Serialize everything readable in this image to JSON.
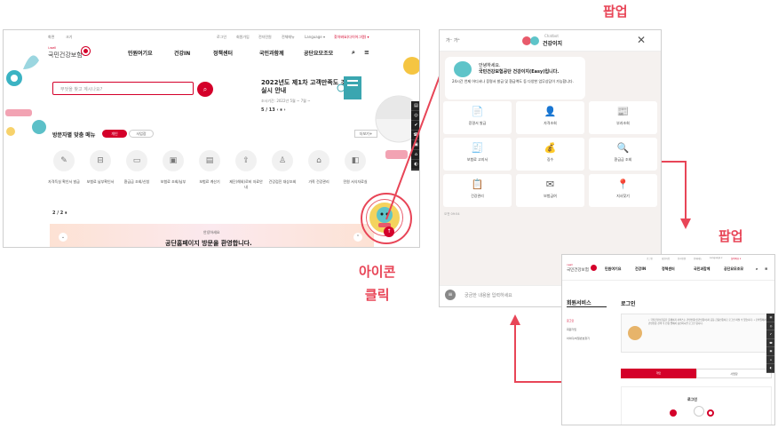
{
  "main_site": {
    "topbar": [
      "화면",
      "크기",
      "로그인",
      "회원가입",
      "전자민원",
      "전체메뉴",
      "Language ▾",
      "찾아봐요(다이어그램) ▾"
    ],
    "logo": {
      "small": "i-well",
      "text": "국민건강보험"
    },
    "gnb": [
      "민원여기요",
      "건강IN",
      "정책센터",
      "국민과함께",
      "공단요모조모"
    ],
    "search_placeholder": "무엇을 찾고 계시나요?",
    "banner": {
      "title": "2022년도 제1차 고객만족도 조사 실시 안내",
      "sub": "조사기간: 2022년 5월 ~ 7월 ~",
      "pager": "5 / 13  ‹  ⏸  ›"
    },
    "visit": {
      "title": "방문자별 맞춤 메뉴",
      "tab_on": "개인",
      "tab_off": "사업장",
      "more": "더보기+"
    },
    "services": [
      {
        "icon": "✎",
        "label": "자격득실 확인서 발급"
      },
      {
        "icon": "⊟",
        "label": "보험료 납부확인서"
      },
      {
        "icon": "▭",
        "label": "환급금 조회/신청"
      },
      {
        "icon": "▣",
        "label": "보험료 조회/납부"
      },
      {
        "icon": "▤",
        "label": "보험료 계산기"
      },
      {
        "icon": "⇪",
        "label": "제단(해외)로비 자료안내"
      },
      {
        "icon": "♙",
        "label": "건강검진 대상조회"
      },
      {
        "icon": "⌂",
        "label": "가족 건강관리"
      },
      {
        "icon": "◧",
        "label": "민원 서식자료실"
      }
    ],
    "pager2": "2 / 2  ⏸",
    "bottom_banner": {
      "small": "안녕하세요",
      "big": "공단홈페이지 방문을 환영합니다."
    }
  },
  "annotations": {
    "popup1": "팝업",
    "popup2": "팝업",
    "icon_click": "아이콘\n클릭"
  },
  "chat": {
    "label": "Chatbot",
    "title": "건강이지",
    "text_size": "가⁻ 가⁺",
    "greeting": "안녕하세요.",
    "greeting2": "국민건강보험공단 건강이지(Easy)입니다.",
    "desc": "24시간 언제 어디서나 증명서 발급 및 환급액도 등 다양한 업무상담이 가능합니다.",
    "tiles": [
      {
        "icon": "📄",
        "label": "증명서 발급"
      },
      {
        "icon": "👤",
        "label": "자격조회"
      },
      {
        "icon": "📰",
        "label": "부과조회"
      },
      {
        "icon": "🧾",
        "label": "보험료 고지서"
      },
      {
        "icon": "💰",
        "label": "징수"
      },
      {
        "icon": "🔍",
        "label": "환급금 조회"
      },
      {
        "icon": "📋",
        "label": "건강관리"
      },
      {
        "icon": "✉",
        "label": "보험급여"
      },
      {
        "icon": "📍",
        "label": "지사찾기"
      }
    ],
    "time": "오전 09:54",
    "input_placeholder": "궁금한 내용을 입력하세요"
  },
  "login_page": {
    "topbar": [
      "로그인",
      "회원가입",
      "전자민원",
      "전체메뉴",
      "Language ▾",
      "찾아봐요 ▾"
    ],
    "gnb": [
      "민원여기요",
      "건강IN",
      "정책센터",
      "국민과함께",
      "공단요모조모"
    ],
    "aside_title": "회원서비스",
    "aside_items": [
      "로그인",
      "회원가입",
      "아이디/비밀번호찾기"
    ],
    "title": "로그인",
    "notice": "• 국민건강보험공단 홈페이지 서비스는 간편인증(민간인증서)과 공동·금융인증서로 로그인 하실 수 있습니다. • 모바일에서 간편인증 선택 후 인증 앱에서 승인하시면 로그인 됩니다.",
    "tab_on": "개인",
    "tab_off": "사업장",
    "card_title": "로그인"
  }
}
